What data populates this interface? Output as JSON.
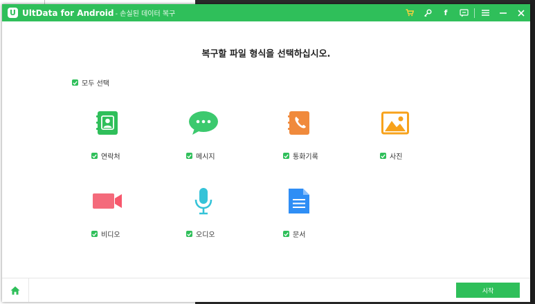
{
  "window": {
    "app_name": "UltData for Android",
    "subtitle": "- 손실된 데이터 복구",
    "logo_letter": "U"
  },
  "toolbar": {
    "icons": [
      "cart-icon",
      "key-icon",
      "facebook-icon",
      "feedback-icon",
      "menu-icon",
      "minimize-icon",
      "close-icon"
    ],
    "facebook_glyph": "f"
  },
  "main": {
    "heading": "복구할 파일 형식을 선택하십시오.",
    "select_all_label": "모두 선택",
    "select_all_checked": true,
    "file_types": [
      {
        "label": "연락처",
        "checked": true,
        "icon": "contacts-icon"
      },
      {
        "label": "메시지",
        "checked": true,
        "icon": "message-icon"
      },
      {
        "label": "통화기록",
        "checked": true,
        "icon": "call-log-icon"
      },
      {
        "label": "사진",
        "checked": true,
        "icon": "photo-icon"
      },
      {
        "label": "비디오",
        "checked": true,
        "icon": "video-icon"
      },
      {
        "label": "오디오",
        "checked": true,
        "icon": "audio-icon"
      },
      {
        "label": "문서",
        "checked": true,
        "icon": "document-icon"
      }
    ]
  },
  "footer": {
    "home_icon": "home-icon",
    "start_label": "시작"
  },
  "colors": {
    "accent": "#2fbf5a",
    "contacts": "#2fbf5a",
    "message": "#3cc96e",
    "call_log": "#f08a3c",
    "photo": "#f7a21b",
    "video": "#f46a7b",
    "audio": "#35c3d8",
    "document": "#2f8ef5"
  }
}
